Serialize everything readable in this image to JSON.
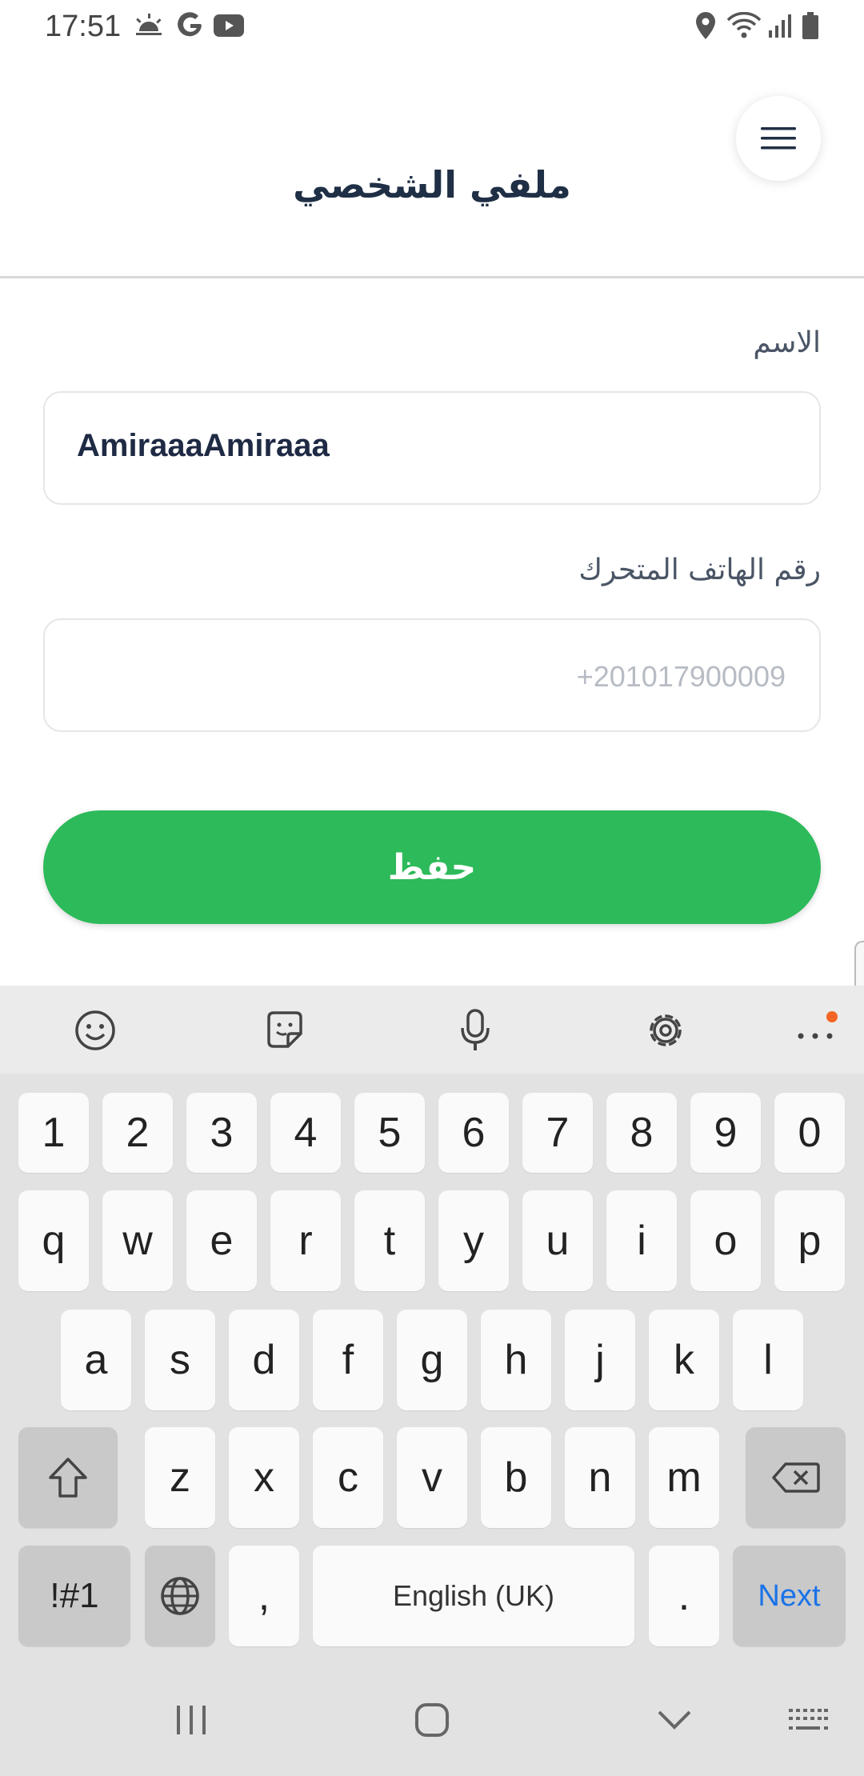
{
  "status_bar": {
    "time": "17:51",
    "icons": [
      "weather-sunrise-icon",
      "google-icon",
      "youtube-icon",
      "location-icon",
      "wifi-icon",
      "signal-icon",
      "battery-icon"
    ]
  },
  "header": {
    "title": "ملفي الشخصي",
    "menu_icon": "hamburger-menu-icon"
  },
  "form": {
    "name_label": "الاسم",
    "name_value": "AmiraaaAmiraaa",
    "phone_label": "رقم الهاتف المتحرك",
    "phone_value": "+201017900009",
    "save_label": "حفظ"
  },
  "colors": {
    "accent": "#2dba5a",
    "title": "#1f2f45",
    "next_key": "#1a73e8",
    "notification_dot": "#f26522"
  },
  "keyboard": {
    "toolbar": [
      "emoji-icon",
      "sticker-icon",
      "microphone-icon",
      "settings-icon",
      "more-icon"
    ],
    "row_numbers": [
      "1",
      "2",
      "3",
      "4",
      "5",
      "6",
      "7",
      "8",
      "9",
      "0"
    ],
    "row_top": [
      "q",
      "w",
      "e",
      "r",
      "t",
      "y",
      "u",
      "i",
      "o",
      "p"
    ],
    "row_middle": [
      "a",
      "s",
      "d",
      "f",
      "g",
      "h",
      "j",
      "k",
      "l"
    ],
    "row_bottom": [
      "z",
      "x",
      "c",
      "v",
      "b",
      "n",
      "m"
    ],
    "symbols_key": "!#1",
    "comma_key": ",",
    "space_label": "English (UK)",
    "period_key": ".",
    "next_label": "Next"
  },
  "nav_bar": [
    "recent-apps-icon",
    "home-icon",
    "back-icon",
    "keyboard-hide-icon"
  ]
}
